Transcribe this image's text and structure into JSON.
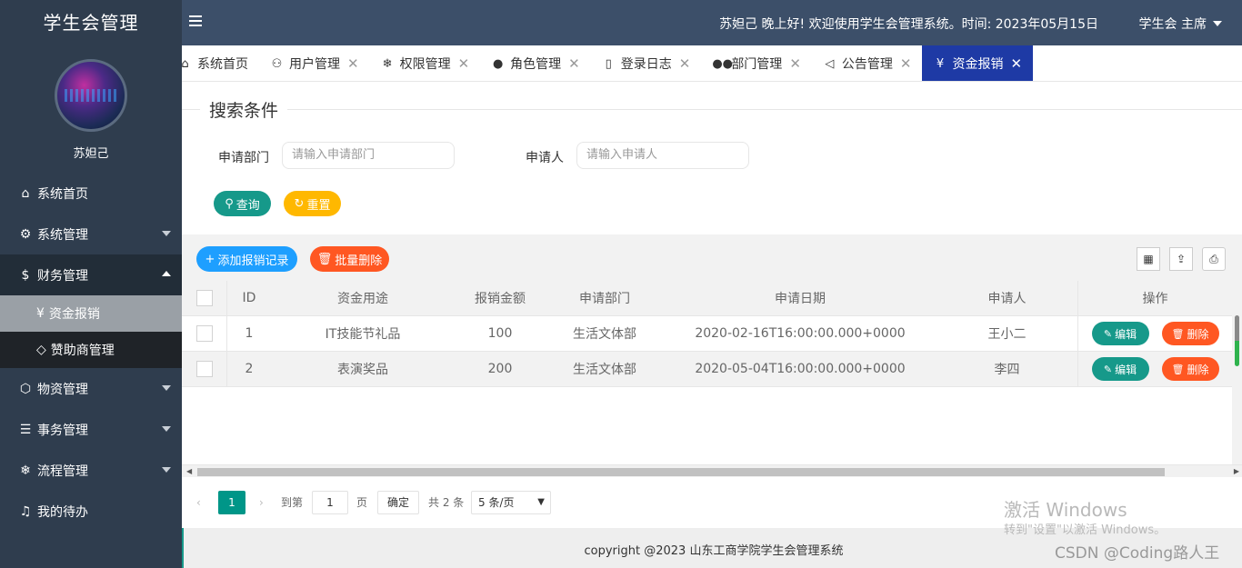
{
  "app": {
    "title": "学生会管理"
  },
  "user": {
    "name": "苏妲己"
  },
  "topbar": {
    "greeting": "苏妲己 晚上好!  欢迎使用学生会管理系统。时间:  2023年05月15日",
    "user_menu": "学生会 主席"
  },
  "sidebar": {
    "items": [
      {
        "label": "系统首页",
        "icon": "home-icon"
      },
      {
        "label": "系统管理",
        "icon": "gear-icon"
      },
      {
        "label": "财务管理",
        "icon": "dollar-icon"
      },
      {
        "label": "物资管理",
        "icon": "box-icon"
      },
      {
        "label": "事务管理",
        "icon": "sliders-icon"
      },
      {
        "label": "流程管理",
        "icon": "snowflake-icon"
      },
      {
        "label": "我的待办",
        "icon": "bell-icon"
      }
    ],
    "sub_items": [
      {
        "label": "资金报销",
        "icon": "yen-icon"
      },
      {
        "label": "赞助商管理",
        "icon": "diamond-icon"
      }
    ]
  },
  "tabs": [
    {
      "label": "系统首页",
      "icon": "home-icon"
    },
    {
      "label": "用户管理",
      "icon": "user-icon"
    },
    {
      "label": "权限管理",
      "icon": "snowflake-icon"
    },
    {
      "label": "角色管理",
      "icon": "person-icon"
    },
    {
      "label": "登录日志",
      "icon": "file-icon"
    },
    {
      "label": "部门管理",
      "icon": "group-icon"
    },
    {
      "label": "公告管理",
      "icon": "speaker-icon"
    },
    {
      "label": "资金报销",
      "icon": "yen-icon"
    }
  ],
  "search": {
    "legend": "搜索条件",
    "dept_label": "申请部门",
    "dept_placeholder": "请输入申请部门",
    "applicant_label": "申请人",
    "applicant_placeholder": "请输入申请人",
    "query_label": "查询",
    "reset_label": "重置"
  },
  "toolbar": {
    "add_label": "添加报销记录",
    "batch_delete_label": "批量删除"
  },
  "table": {
    "headers": [
      "ID",
      "资金用途",
      "报销金额",
      "申请部门",
      "申请日期",
      "申请人",
      "操作"
    ],
    "rows": [
      [
        "1",
        "IT技能节礼品",
        "100",
        "生活文体部",
        "2020-02-16T16:00:00.000+0000",
        "王小二"
      ],
      [
        "2",
        "表演奖品",
        "200",
        "生活文体部",
        "2020-05-04T16:00:00.000+0000",
        "李四"
      ]
    ],
    "edit_label": "编辑",
    "delete_label": "删除"
  },
  "pagination": {
    "current": "1",
    "goto_label": "到第",
    "goto_value": "1",
    "page_label": "页",
    "confirm_label": "确定",
    "total": "共 2 条",
    "page_size": "5 条/页"
  },
  "footer": {
    "copyright": "copyright @2023 山东工商学院学生会管理系统"
  },
  "watermark": {
    "line1": "激活 Windows",
    "line2": "转到\"设置\"以激活 Windows。",
    "csdn": "CSDN @Coding路人王"
  }
}
